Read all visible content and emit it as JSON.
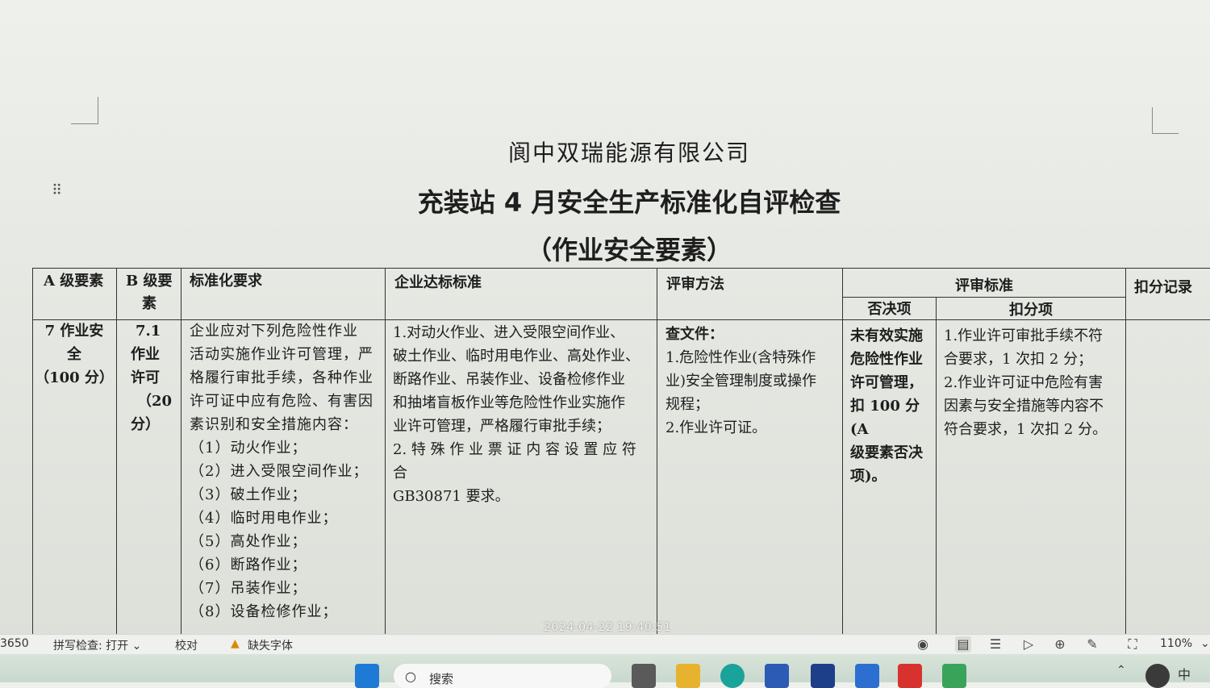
{
  "document": {
    "company": "阆中双瑞能源有限公司",
    "title": "充装站 4 月安全生产标准化自评检查",
    "subtitle": "（作业安全要素）",
    "table": {
      "headers": {
        "a_level": "A 级要素",
        "b_level": [
          "B 级要",
          "素"
        ],
        "standard_req": "标准化要求",
        "enterprise_std": "企业达标标准",
        "review_method": "评审方法",
        "review_criteria": "评审标准",
        "veto": "否决项",
        "deduction": "扣分项",
        "record": "扣分记录"
      },
      "row": {
        "a_level": [
          "7 作业安",
          "全",
          "（100 分）"
        ],
        "b_level": [
          "7.1",
          "作业",
          "许可",
          "（20",
          "分）"
        ],
        "standard_req_intro": [
          "企业应对下列危险性作业",
          "活动实施作业许可管理，严",
          "格履行审批手续，各种作业",
          "许可证中应有危险、有害因",
          "素识别和安全措施内容："
        ],
        "standard_req_items": [
          "（1）动火作业；",
          "（2）进入受限空间作业；",
          "（3）破土作业；",
          "（4）临时用电作业；",
          "（5）高处作业；",
          "（6）断路作业；",
          "（7）吊装作业；",
          "（8）设备检修作业；"
        ],
        "enterprise_std": [
          "1.对动火作业、进入受限空间作业、",
          "破土作业、临时用电作业、高处作业、",
          "断路作业、吊装作业、设备检修作业",
          "和抽堵盲板作业等危险性作业实施作",
          "业许可管理，严格履行审批手续；",
          "2. 特 殊 作 业 票 证 内 容 设 置 应 符 合",
          "GB30871 要求。"
        ],
        "review_method_head": "查文件：",
        "review_method": [
          "1.危险性作业(含特殊作",
          "业)安全管理制度或操作",
          "规程；",
          "2.作业许可证。"
        ],
        "veto": [
          "未有效实施",
          "危险性作业",
          "许可管理，",
          "扣 100 分(A",
          "级要素否决",
          "项)。"
        ],
        "deduction": [
          "1.作业许可审批手续不符",
          "合要求，1 次扣 2 分；",
          "2.作业许可证中危险有害",
          "因素与安全措施等内容不",
          "符合要求，1 次扣 2 分。"
        ]
      }
    }
  },
  "statusbar": {
    "word_count": "3650",
    "spellcheck": "拼写检查: 打开",
    "proofread": "校对",
    "missing_font": "缺失字体",
    "zoom": "110%"
  },
  "timestamp": "2024-04-22 19:40:51",
  "taskbar": {
    "search_placeholder": "搜索"
  }
}
